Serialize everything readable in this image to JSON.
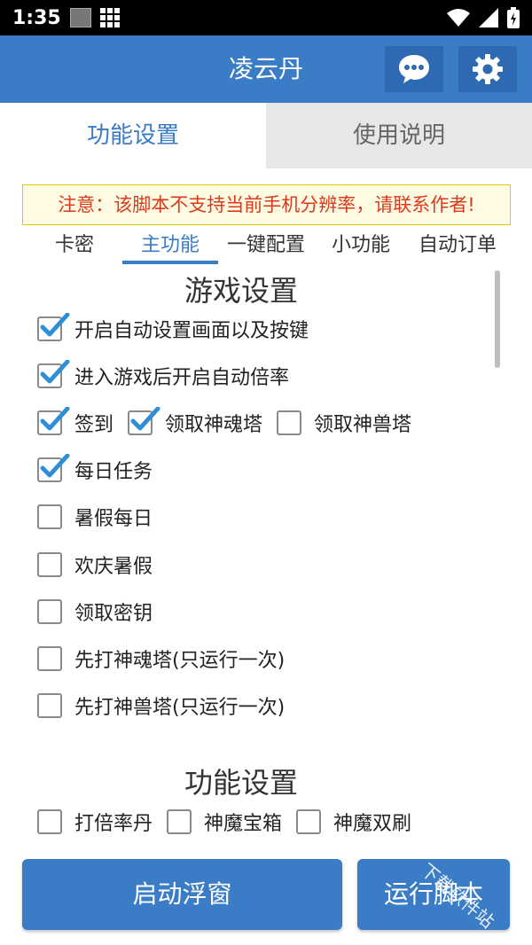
{
  "status_bar": {
    "time": "1:35"
  },
  "app_bar": {
    "title": "凌云丹"
  },
  "top_tabs": [
    {
      "label": "功能设置",
      "active": true
    },
    {
      "label": "使用说明",
      "active": false
    }
  ],
  "warning": "注意：该脚本不支持当前手机分辨率，请联系作者!",
  "sub_tabs": [
    {
      "label": "卡密"
    },
    {
      "label": "主功能",
      "active": true
    },
    {
      "label": "一键配置"
    },
    {
      "label": "小功能"
    },
    {
      "label": "自动订单"
    }
  ],
  "game_settings": {
    "title": "游戏设置",
    "options": [
      {
        "label": "开启自动设置画面以及按键",
        "checked": true
      },
      {
        "label": "进入游戏后开启自动倍率",
        "checked": true
      },
      {
        "label": "签到",
        "checked": true
      },
      {
        "label": "领取神魂塔",
        "checked": true
      },
      {
        "label": "领取神兽塔",
        "checked": false
      },
      {
        "label": "每日任务",
        "checked": true
      },
      {
        "label": "暑假每日",
        "checked": false
      },
      {
        "label": "欢庆暑假",
        "checked": false
      },
      {
        "label": "领取密钥",
        "checked": false
      },
      {
        "label": "先打神魂塔(只运行一次)",
        "checked": false
      },
      {
        "label": "先打神兽塔(只运行一次)",
        "checked": false
      }
    ]
  },
  "function_settings": {
    "title": "功能设置",
    "options": [
      {
        "label": "打倍率丹",
        "checked": false
      },
      {
        "label": "神魔宝箱",
        "checked": false
      },
      {
        "label": "神魔双刷",
        "checked": false
      }
    ]
  },
  "buttons": {
    "float_window": "启动浮窗",
    "run_script": "运行脚本"
  },
  "watermark": "下载软件站",
  "colors": {
    "primary": "#3a7cc6",
    "warning_text": "#d93a1e",
    "check": "#2f8fd6"
  }
}
